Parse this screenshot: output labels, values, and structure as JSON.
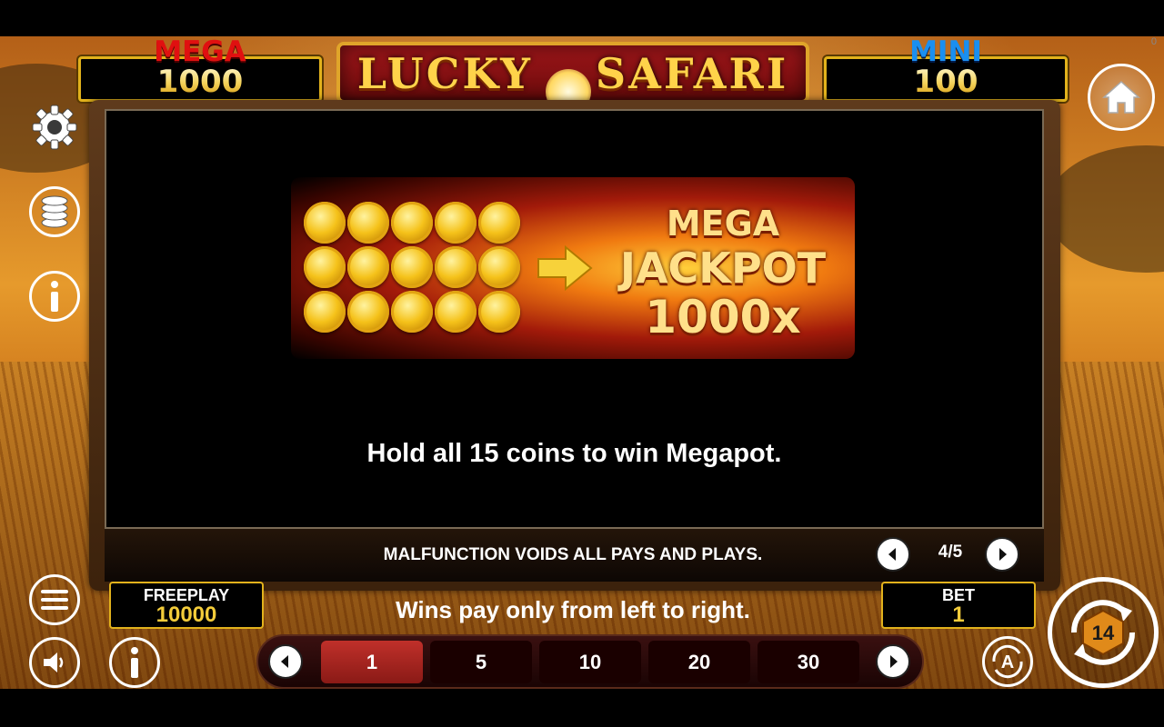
{
  "jackpots": {
    "mega": {
      "label": "MEGA",
      "value": "1000",
      "color": "#e01010"
    },
    "mini": {
      "label": "MINI",
      "value": "100",
      "color": "#1a7fe8"
    }
  },
  "logo": {
    "text": "LUCKY SAFARI"
  },
  "corner_marker": "0",
  "sidebar": {
    "settings_icon": "gear-icon",
    "coins_icon": "coin-stack-icon",
    "info_icon": "info-icon",
    "menu_icon": "menu-icon",
    "sound_icon": "speaker-icon",
    "home_icon": "home-icon"
  },
  "paytable_page": {
    "jackpot_graphic": {
      "line1": "MEGA",
      "line2": "JACKPOT",
      "line3": "1000x",
      "coin_count": 15
    },
    "description": "Hold all 15 coins to win Megapot.",
    "malfunction": "MALFUNCTION VOIDS ALL PAYS AND PLAYS.",
    "page_indicator": "4/5"
  },
  "freeplay": {
    "label": "FREEPLAY",
    "value": "10000"
  },
  "bet": {
    "label": "BET",
    "value": "1"
  },
  "wins_notice": "Wins pay only from left to right.",
  "bet_options": [
    "1",
    "5",
    "10",
    "20",
    "30"
  ],
  "selected_bet": "1",
  "spin_button": {
    "digits": "14"
  },
  "autoplay_label": "A"
}
